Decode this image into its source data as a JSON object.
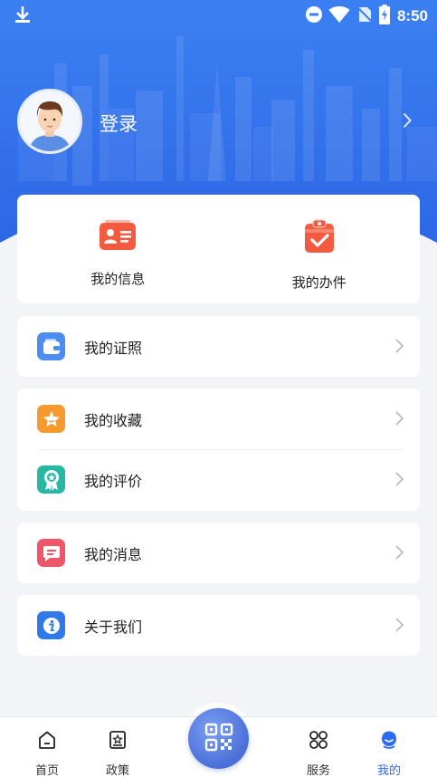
{
  "status_bar": {
    "time": "8:50"
  },
  "profile": {
    "login_label": "登录"
  },
  "quick_actions": [
    {
      "label": "我的信息",
      "icon": "id-card-icon"
    },
    {
      "label": "我的办件",
      "icon": "clipboard-check-icon"
    }
  ],
  "menu": {
    "group1": [
      {
        "label": "我的证照",
        "icon": "wallet-icon"
      }
    ],
    "group2": [
      {
        "label": "我的收藏",
        "icon": "star-icon"
      },
      {
        "label": "我的评价",
        "icon": "medal-icon"
      }
    ],
    "group3": [
      {
        "label": "我的消息",
        "icon": "message-icon"
      }
    ],
    "group4": [
      {
        "label": "关于我们",
        "icon": "info-icon"
      }
    ]
  },
  "bottom_nav": [
    {
      "label": "首页",
      "icon": "home-icon"
    },
    {
      "label": "政策",
      "icon": "policy-icon"
    },
    {
      "label": "服务",
      "icon": "grid-icon"
    },
    {
      "label": "我的",
      "icon": "profile-icon",
      "active": true
    }
  ],
  "colors": {
    "primary": "#2c6cf0",
    "hero_top": "#3a7bf0",
    "hero_bottom": "#2f6ae8"
  }
}
